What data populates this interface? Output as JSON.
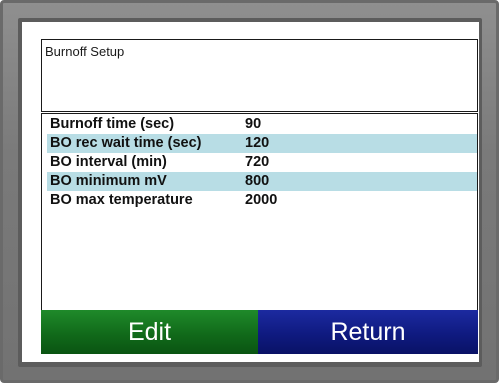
{
  "screen": {
    "title": "Burnoff Setup"
  },
  "settings": [
    {
      "label": "Burnoff time (sec)",
      "value": "90",
      "highlighted": false
    },
    {
      "label": "BO rec wait time (sec)",
      "value": "120",
      "highlighted": true
    },
    {
      "label": "BO interval (min)",
      "value": "720",
      "highlighted": false
    },
    {
      "label": "BO minimum mV",
      "value": "800",
      "highlighted": true
    },
    {
      "label": "BO max temperature",
      "value": "2000",
      "highlighted": false
    }
  ],
  "buttons": {
    "edit_label": "Edit",
    "return_label": "Return"
  },
  "colors": {
    "row_highlight": "#b8dde5",
    "edit_button": "#116a1a",
    "return_button": "#0f1a80",
    "bezel": "#7a7a7a"
  }
}
